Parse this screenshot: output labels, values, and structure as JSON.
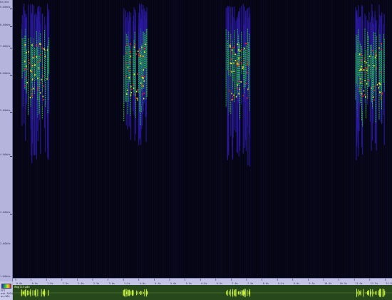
{
  "freq_axis": {
    "header": "Hz/kHz",
    "ticks": [
      "9.00kHz",
      "8.00kHz",
      "7.00kHz",
      "6.00kHz",
      "5.00kHz",
      "4.00kHz",
      "3.00kHz",
      "2.00kHz",
      "1.00kHz"
    ]
  },
  "time_axis": {
    "ticks": [
      "0.0s",
      "0.5s",
      "1.0s",
      "1.5s",
      "2.0s",
      "2.5s",
      "3.0s",
      "3.5s",
      "4.0s",
      "4.5s",
      "5.0s",
      "5.5s",
      "6.0s",
      "6.5s",
      "7.0s",
      "7.5s",
      "8.0s",
      "8.5s",
      "9.0s",
      "9.5s",
      "10.0s",
      "10.5s",
      "11.0s",
      "11.5s",
      "12.0s"
    ]
  },
  "corner": {
    "palette_icon": "color-palette-icon",
    "labels": [
      "FFT",
      "win:1024",
      "ov:50%"
    ]
  },
  "waveform": {
    "title": "Amplitude"
  },
  "colors": {
    "background": "#050512",
    "low": "#2a1aa0",
    "mid": "#20c040",
    "high": "#e8e020",
    "peak": "#e02020",
    "waveform_bg": "#26481a",
    "waveform_trace": "#c8f040"
  }
}
